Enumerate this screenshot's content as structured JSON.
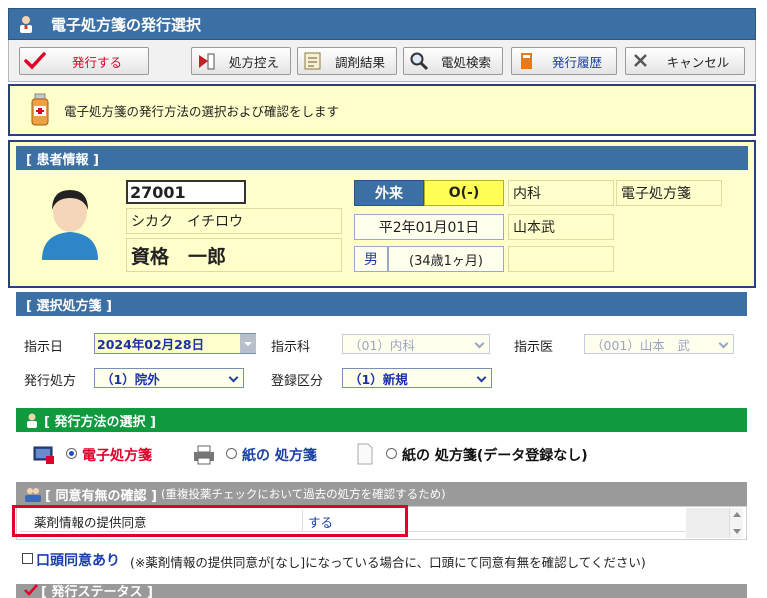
{
  "window": {
    "title": "電子処方箋の発行選択"
  },
  "toolbar": {
    "issue": "発行する",
    "rx_copy": "処方控え",
    "dispense_result": "調剤結果",
    "erx_search": "電処検索",
    "history": "発行履歴",
    "cancel": "キャンセル"
  },
  "info": {
    "message": "電子処方箋の発行方法の選択および確認をします"
  },
  "patient": {
    "header": "[ 患者情報 ]",
    "id": "27001",
    "kana": "シカク　イチロウ",
    "name": "資格　一郎",
    "visit_type": "外来",
    "insurance": "O(-)",
    "department": "内科",
    "rx_kind": "電子処方箋",
    "birthdate": "平2年01月01日",
    "doctor": "山本武",
    "sex": "男",
    "age": "(34歳1ヶ月)"
  },
  "selected": {
    "header": "[ 選択処方箋 ]",
    "date_label": "指示日",
    "date_value": "2024年02月28日",
    "dept_label": "指示科",
    "dept_value": "（01）内科",
    "doctor_label": "指示医",
    "doctor_value": "（001）山本　武",
    "issue_label": "発行処方",
    "issue_value": "（1）院外",
    "reg_label": "登録区分",
    "reg_value": "（1）新規"
  },
  "method": {
    "header": "[ 発行方法の選択 ]",
    "opt_electronic": "電子処方箋",
    "opt_paper": "紙の 処方箋",
    "opt_paper_noreg": "紙の 処方箋(データ登録なし)"
  },
  "consent": {
    "header": "[ 同意有無の確認 ]",
    "header_note": "(重複投薬チェックにおいて過去の処方を確認するため)",
    "row_label": "薬剤情報の提供同意",
    "row_value": "する",
    "oral_label": "口頭同意あり",
    "oral_note": "(※薬剤情報の提供同意が[なし]になっている場合に、口頭にて同意有無を確認してください)"
  },
  "status": {
    "header": "[ 発行ステータス ]"
  },
  "colors": {
    "title_bar": "#3c6fa3",
    "green_header": "#0f9a3e",
    "highlight_red": "#e0002a"
  }
}
